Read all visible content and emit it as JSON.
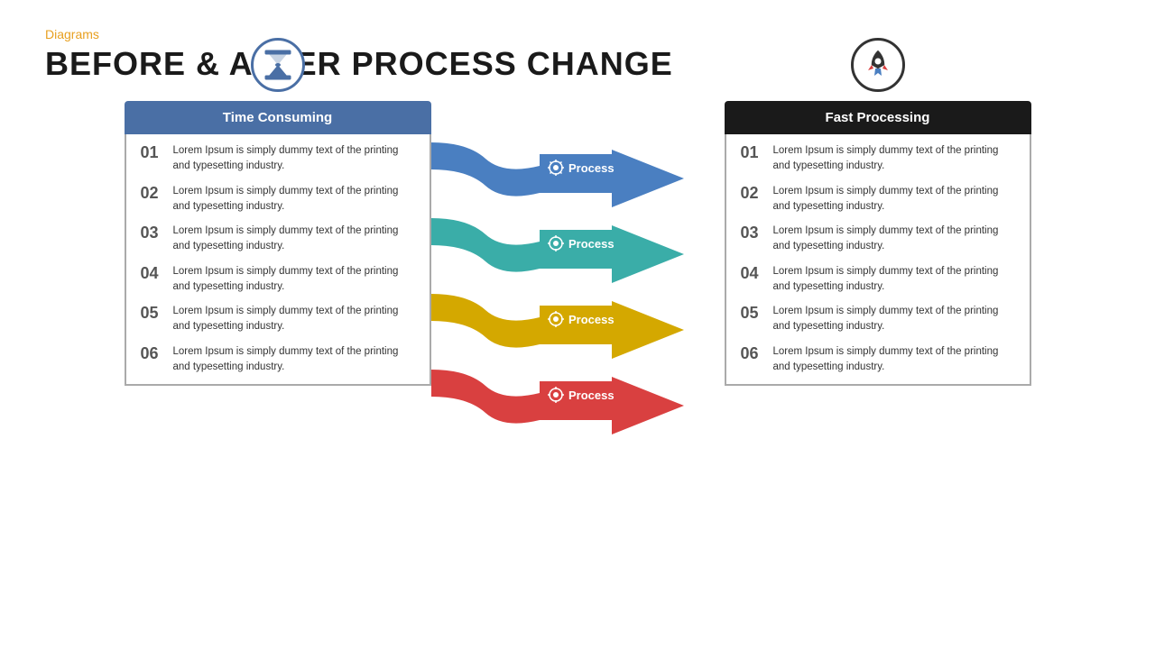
{
  "header": {
    "category": "Diagrams",
    "title": "BEFORE & AFTER PROCESS CHANGE"
  },
  "left_panel": {
    "icon_label": "hourglass",
    "heading": "Time Consuming",
    "items": [
      {
        "number": "01",
        "text": "Lorem Ipsum is simply dummy text of the printing and typesetting industry."
      },
      {
        "number": "02",
        "text": "Lorem Ipsum is simply dummy text of the printing and typesetting industry."
      },
      {
        "number": "03",
        "text": "Lorem Ipsum is simply dummy text of the printing and typesetting industry."
      },
      {
        "number": "04",
        "text": "Lorem Ipsum is simply dummy text of the printing and typesetting industry."
      },
      {
        "number": "05",
        "text": "Lorem Ipsum is simply dummy text of the printing and typesetting industry."
      },
      {
        "number": "06",
        "text": "Lorem Ipsum is simply dummy text of the printing and typesetting industry."
      }
    ]
  },
  "process_arrows": [
    {
      "label": "Process",
      "color": "#4a7fc1"
    },
    {
      "label": "Process",
      "color": "#3aada8"
    },
    {
      "label": "Process",
      "color": "#d4a800"
    },
    {
      "label": "Process",
      "color": "#d94040"
    }
  ],
  "right_panel": {
    "icon_label": "rocket",
    "heading": "Fast Processing",
    "items": [
      {
        "number": "01",
        "text": "Lorem Ipsum is simply dummy text of the printing and typesetting industry."
      },
      {
        "number": "02",
        "text": "Lorem Ipsum is simply dummy text of the printing and typesetting industry."
      },
      {
        "number": "03",
        "text": "Lorem Ipsum is simply dummy text of the printing and typesetting industry."
      },
      {
        "number": "04",
        "text": "Lorem Ipsum is simply dummy text of the printing and typesetting industry."
      },
      {
        "number": "05",
        "text": "Lorem Ipsum is simply dummy text of the printing and typesetting industry."
      },
      {
        "number": "06",
        "text": "Lorem Ipsum is simply dummy text of the printing and typesetting industry."
      }
    ]
  },
  "colors": {
    "orange": "#e8a020",
    "blue_panel": "#4a6fa5",
    "black_panel": "#1a1a1a",
    "process_blue": "#4a7fc1",
    "process_teal": "#3aada8",
    "process_yellow": "#d4a800",
    "process_red": "#d94040"
  }
}
